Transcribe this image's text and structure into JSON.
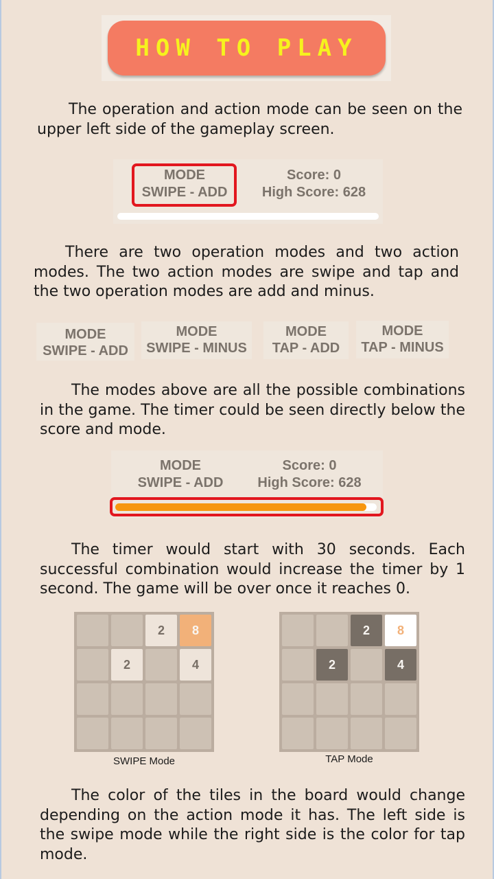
{
  "title": "HOW TO PLAY",
  "paragraphs": {
    "p1": "The operation and action mode can be seen on the upper left side of the gameplay screen.",
    "p2": "There are two operation modes and two action modes. The two action modes are swipe and tap and the two operation modes are add and minus.",
    "p3": "The modes above are all the possible combinations in the game. The timer could be seen directly below the score and mode.",
    "p4": "The timer would start with 30 seconds. Each successful combination would increase the timer by 1 second. The game will be over once it reaches 0.",
    "p5": "The color of the tiles in the board would change depending on the action mode it has. The left side is the swipe mode while the right side is the color for tap mode."
  },
  "example1": {
    "mode_label": "MODE",
    "mode_value": "SWIPE - ADD",
    "score": "Score: 0",
    "high_score": "High Score: 628"
  },
  "modes": [
    {
      "label": "MODE",
      "value": "SWIPE - ADD"
    },
    {
      "label": "MODE",
      "value": "SWIPE - MINUS"
    },
    {
      "label": "MODE",
      "value": "TAP - ADD"
    },
    {
      "label": "MODE",
      "value": "TAP - MINUS"
    }
  ],
  "example2": {
    "mode_label": "MODE",
    "mode_value": "SWIPE - ADD",
    "score": "Score: 0",
    "high_score": "High Score: 628",
    "timer_fraction": 0.96,
    "timer_color": "#f7960f"
  },
  "boards": {
    "swipe": {
      "caption": "SWIPE Mode",
      "tiles": [
        {
          "row": 0,
          "col": 2,
          "value": "2"
        },
        {
          "row": 0,
          "col": 3,
          "value": "8"
        },
        {
          "row": 1,
          "col": 1,
          "value": "2"
        },
        {
          "row": 1,
          "col": 3,
          "value": "4"
        }
      ],
      "colors": {
        "tile_light": "#eee4da",
        "tile_8": "#f2b179",
        "text_dark": "#776e65",
        "text_light": "#f9f6f2"
      }
    },
    "tap": {
      "caption": "TAP Mode",
      "tiles": [
        {
          "row": 0,
          "col": 2,
          "value": "2"
        },
        {
          "row": 0,
          "col": 3,
          "value": "8"
        },
        {
          "row": 1,
          "col": 1,
          "value": "2"
        },
        {
          "row": 1,
          "col": 3,
          "value": "4"
        }
      ],
      "colors": {
        "tile_dark": "#776e65",
        "tile_8": "#ffffff",
        "text_light": "#f9f6f2",
        "text_8": "#f2b179"
      }
    }
  }
}
